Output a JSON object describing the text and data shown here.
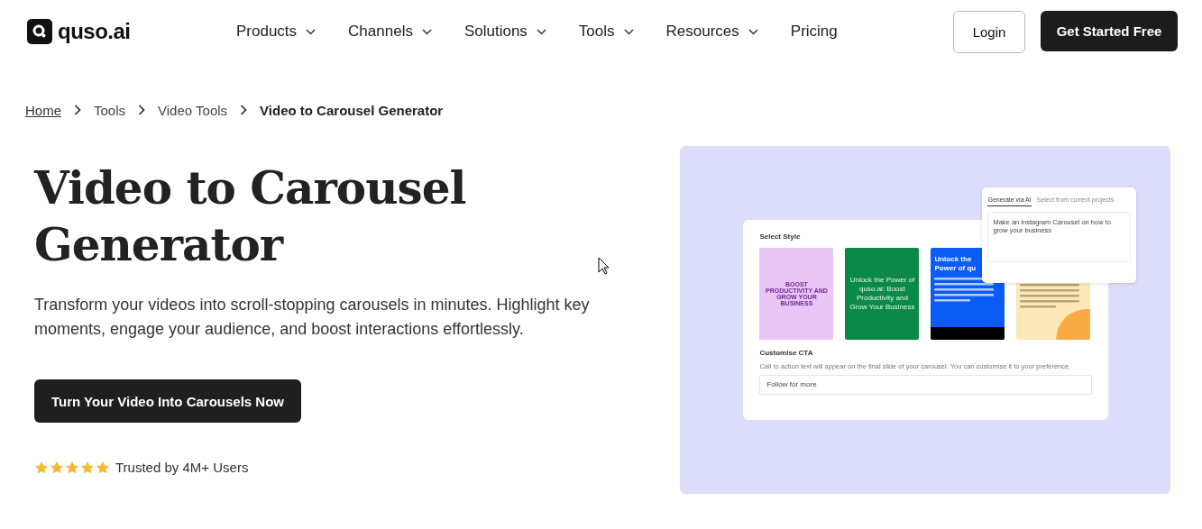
{
  "header": {
    "logo": "quso.ai",
    "nav": [
      {
        "label": "Products",
        "has_menu": true
      },
      {
        "label": "Channels",
        "has_menu": true
      },
      {
        "label": "Solutions",
        "has_menu": true
      },
      {
        "label": "Tools",
        "has_menu": true
      },
      {
        "label": "Resources",
        "has_menu": true
      },
      {
        "label": "Pricing",
        "has_menu": false
      }
    ],
    "login": "Login",
    "cta": "Get Started Free"
  },
  "breadcrumb": [
    {
      "label": "Home",
      "kind": "link"
    },
    {
      "label": "Tools",
      "kind": "text"
    },
    {
      "label": "Video Tools",
      "kind": "text"
    },
    {
      "label": "Video to Carousel Generator",
      "kind": "current"
    }
  ],
  "hero": {
    "title": "Video to Carousel Generator",
    "description": "Transform your videos into scroll-stopping carousels in minutes. Highlight key moments, engage your audience, and boost interactions effortlessly.",
    "button": "Turn Your Video Into Carousels Now",
    "stars": 5,
    "trust": "Trusted by 4M+ Users"
  },
  "mockup": {
    "style_heading": "Select Style",
    "styles": [
      {
        "kind": "pink",
        "title": "BOOST PRODUCTIVITY AND GROW YOUR BUSINESS"
      },
      {
        "kind": "green",
        "title": "Unlock the Power of quso.ai: Boost Productivity and Grow Your Business"
      },
      {
        "kind": "blue",
        "title": "Unlock the Power of qu"
      },
      {
        "kind": "yellow"
      }
    ],
    "cta_heading": "Customise CTA",
    "cta_hint": "Call to action text will appear on the final slide of your carousel. You can customise it to your preference.",
    "cta_value": "Follow for more",
    "tabs": [
      {
        "label": "Generate via AI",
        "selected": true
      },
      {
        "label": "Select from current projects",
        "selected": false
      }
    ],
    "prompt": "Make an instagram Carousel on how to grow your business"
  }
}
